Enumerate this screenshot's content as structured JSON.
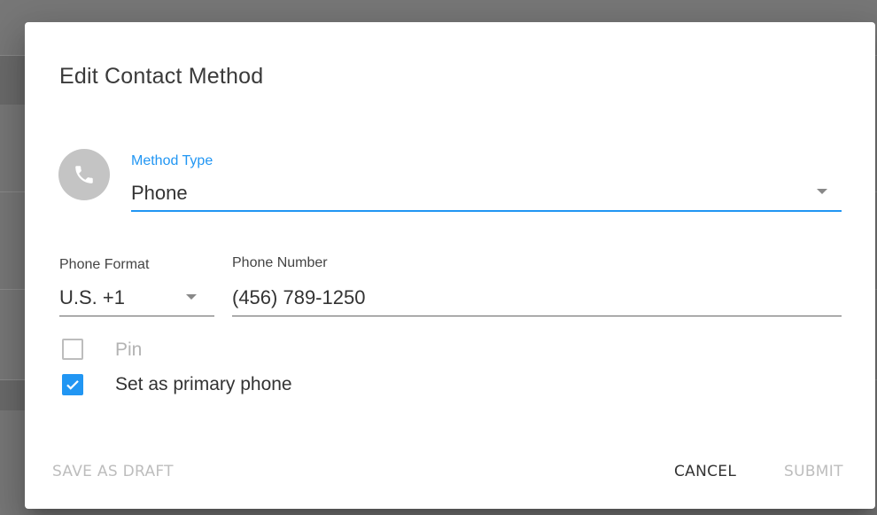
{
  "dialog": {
    "title": "Edit Contact Method",
    "method_type": {
      "label": "Method Type",
      "value": "Phone",
      "icon": "phone-icon"
    },
    "phone_format": {
      "label": "Phone Format",
      "value": "U.S. +1"
    },
    "phone_number": {
      "label": "Phone Number",
      "value": "(456) 789-1250"
    },
    "pin": {
      "label": "Pin",
      "checked": false,
      "disabled": true
    },
    "primary": {
      "label": "Set as primary phone",
      "checked": true
    },
    "actions": {
      "save_draft": "SAVE AS DRAFT",
      "cancel": "CANCEL",
      "submit": "SUBMIT"
    }
  },
  "colors": {
    "accent": "#2196f3",
    "icon_bg": "#c4c4c4",
    "disabled_text": "#bdbdbd"
  }
}
